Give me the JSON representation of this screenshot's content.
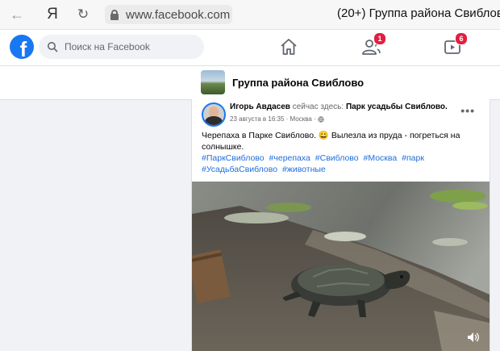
{
  "browser": {
    "url": "www.facebook.com",
    "tab_title": "(20+) Группа района Свиблово",
    "yandex_label": "Я"
  },
  "header": {
    "search_placeholder": "Поиск на Facebook",
    "logo": "f",
    "friends_badge": "1",
    "watch_badge": "6"
  },
  "group": {
    "name": "Группа района Свиблово"
  },
  "post": {
    "author": "Игорь Авдасев",
    "checkin_text": "сейчас здесь:",
    "place": "Парк усадьбы Свиблово.",
    "timestamp": "23 августа в 16:35 · Москва ·",
    "text": "Черепаха в Парке Свиблово. 😀 Вылезла из пруда - погреться на солнышке.",
    "hashtags": [
      "#ПаркСвиблово",
      "#черепаха",
      "#Свиблово",
      "#Москва",
      "#парк",
      "#УсадьбаСвиблово",
      "#животные"
    ],
    "more": "•••"
  },
  "colors": {
    "brand": "#1877f2",
    "badge": "#e41e3f",
    "link": "#216fdb"
  },
  "icons": [
    "back-icon",
    "reload-icon",
    "lock-icon",
    "search-icon",
    "home-icon",
    "friends-icon",
    "watch-icon",
    "globe-icon",
    "more-icon",
    "sound-icon"
  ]
}
